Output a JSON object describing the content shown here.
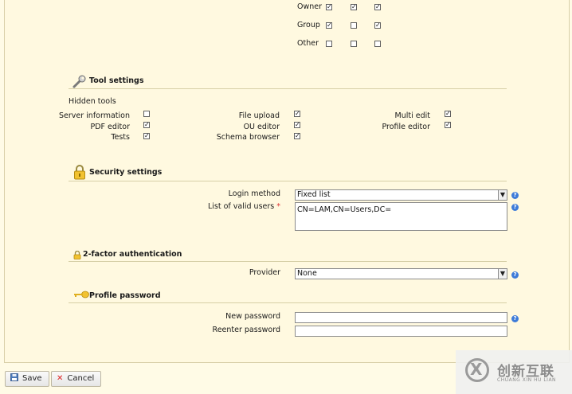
{
  "permissions": {
    "rows": [
      {
        "label": "Owner",
        "checks": [
          true,
          true,
          true
        ]
      },
      {
        "label": "Group",
        "checks": [
          true,
          false,
          true
        ]
      },
      {
        "label": "Other",
        "checks": [
          false,
          false,
          false
        ]
      }
    ]
  },
  "tool_settings": {
    "title": "Tool settings",
    "hidden_tools_label": "Hidden tools",
    "tools": [
      {
        "label": "Server information",
        "checked": false
      },
      {
        "label": "PDF editor",
        "checked": true
      },
      {
        "label": "Tests",
        "checked": true
      },
      {
        "label": "File upload",
        "checked": true
      },
      {
        "label": "OU editor",
        "checked": true
      },
      {
        "label": "Schema browser",
        "checked": true
      },
      {
        "label": "Multi edit",
        "checked": true
      },
      {
        "label": "Profile editor",
        "checked": true
      }
    ]
  },
  "security_settings": {
    "title": "Security settings",
    "login_method_label": "Login method",
    "login_method_value": "Fixed list",
    "valid_users_label": "List of valid users",
    "required_mark": "*",
    "valid_users_value": "CN=LAM,CN=Users,DC="
  },
  "two_factor": {
    "title": "2-factor authentication",
    "provider_label": "Provider",
    "provider_value": "None"
  },
  "profile_password": {
    "title": "Profile password",
    "new_password_label": "New password",
    "reenter_password_label": "Reenter password"
  },
  "help_glyph": "?",
  "footer": {
    "save_label": "Save",
    "cancel_label": "Cancel"
  },
  "watermark": {
    "logo_glyph": "X",
    "cn_text": "创新互联",
    "en_text": "CHUANG XIN HU LIAN"
  },
  "icons": {
    "tool": "wrench-icon",
    "lock": "padlock-icon",
    "key": "key-icon",
    "save": "save-icon",
    "cancel": "cancel-icon"
  },
  "colors": {
    "background": "#fffbe6",
    "help_icon": "#3d7bd9",
    "required": "#dd3333"
  }
}
